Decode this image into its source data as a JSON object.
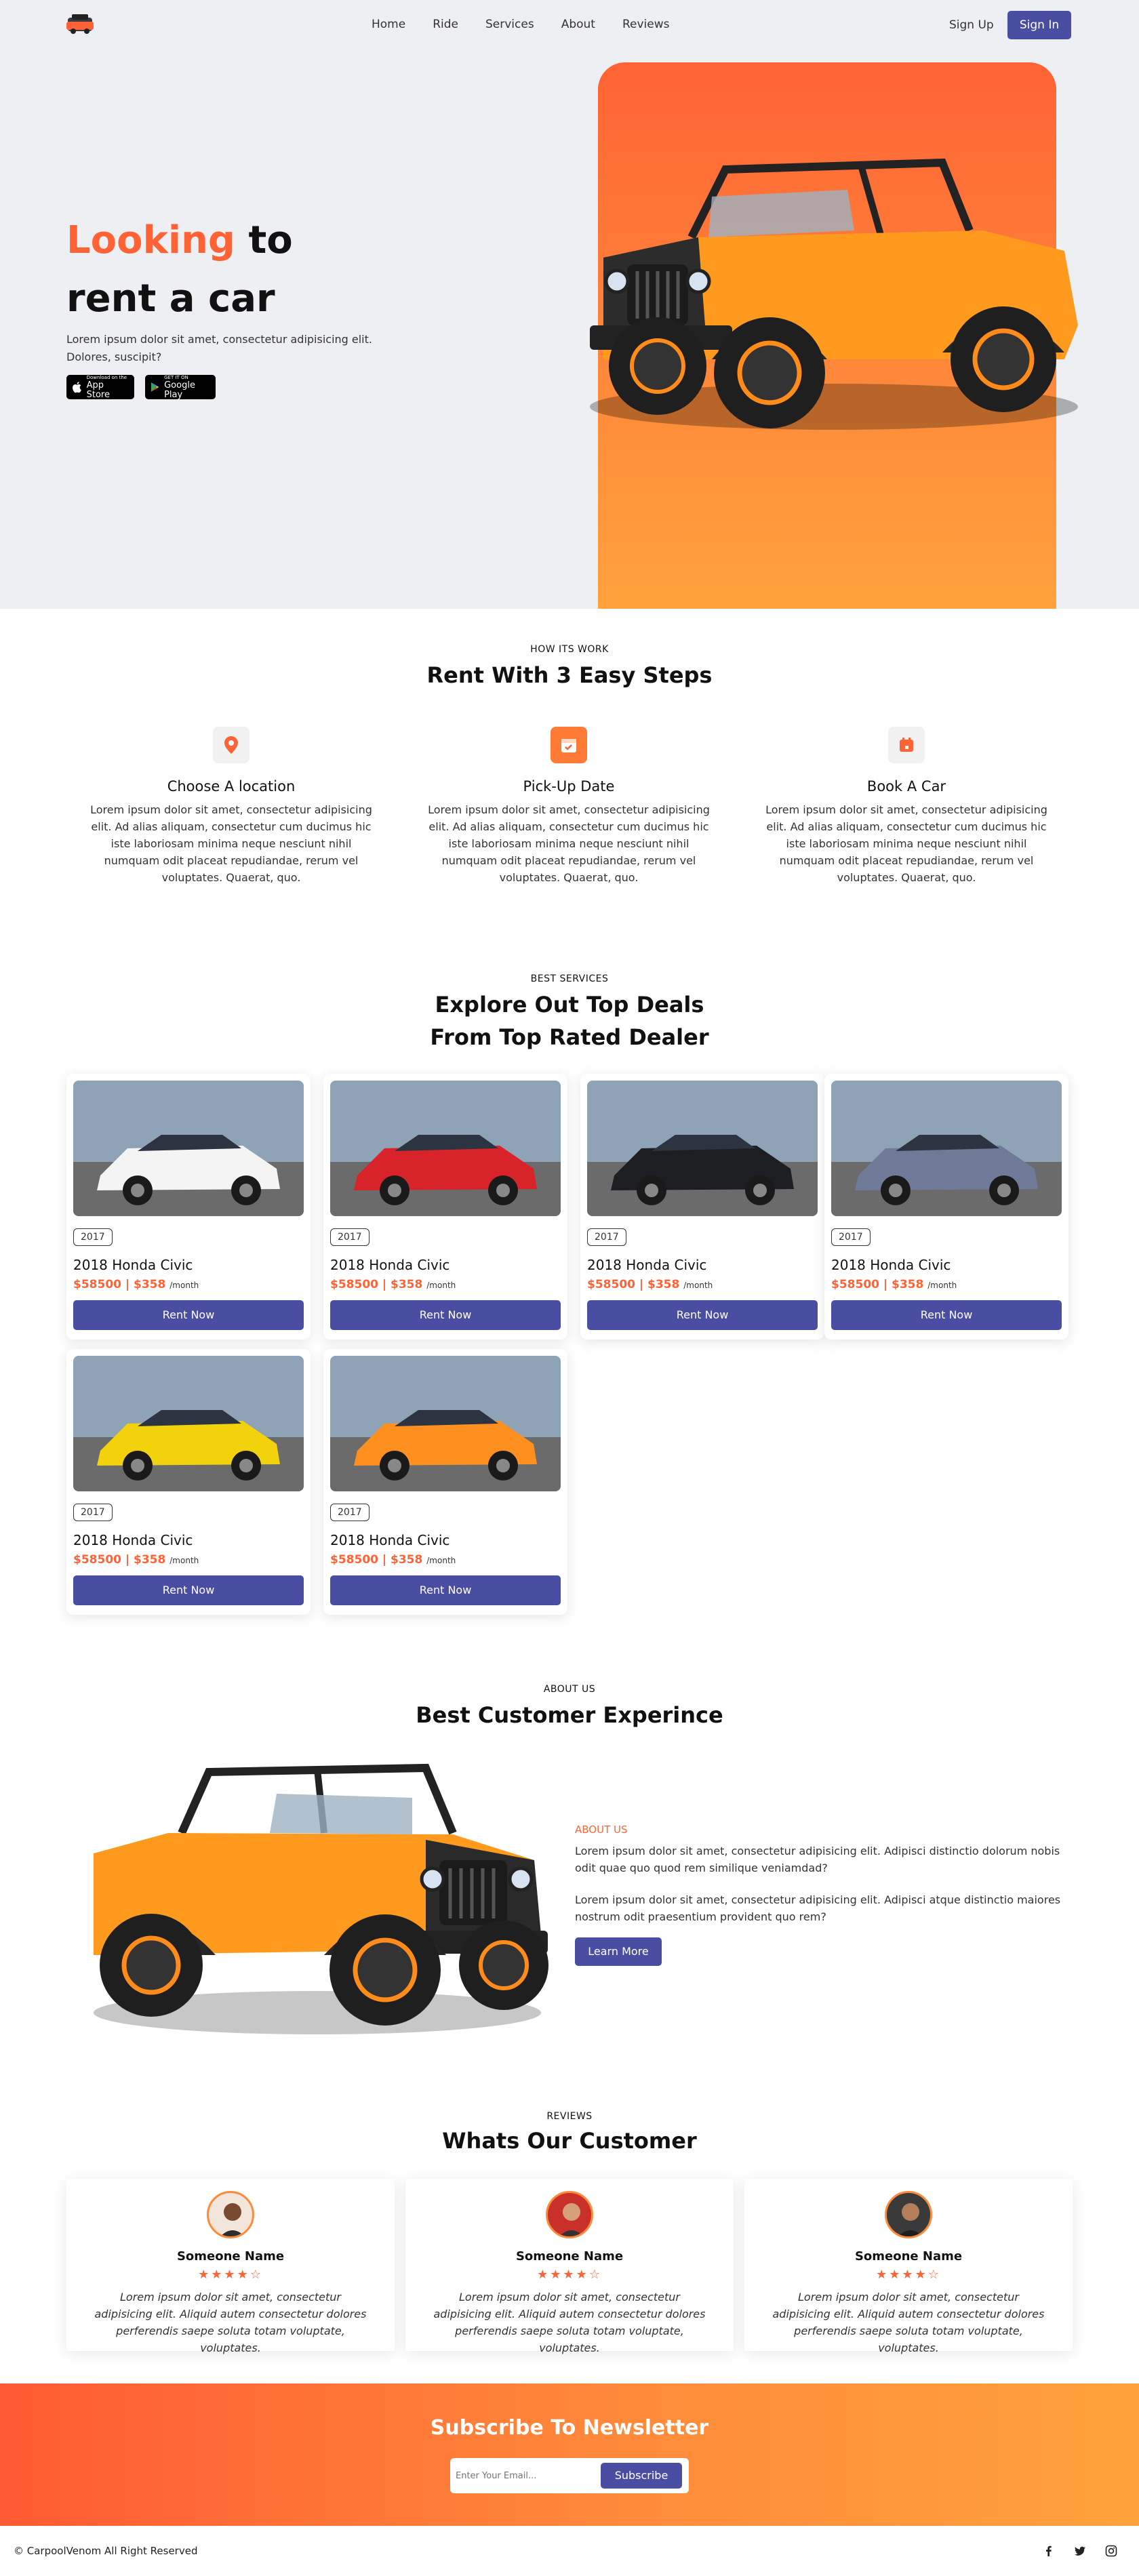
{
  "nav": {
    "links": [
      "Home",
      "Ride",
      "Services",
      "About",
      "Reviews"
    ],
    "signup": "Sign Up",
    "signin": "Sign In"
  },
  "hero": {
    "title_accent": "Looking",
    "title_rest1": "to",
    "title_line2": "rent a car",
    "description": "Lorem ipsum dolor sit amet, consectetur adipisicing elit. Dolores, suscipit?",
    "appstore_small": "Download on the",
    "appstore_big": "App Store",
    "googleplay_small": "GET IT ON",
    "googleplay_big": "Google Play"
  },
  "steps": {
    "kicker": "HOW ITS WORK",
    "title": "Rent With 3 Easy Steps",
    "items": [
      {
        "title": "Choose A location",
        "text": "Lorem ipsum dolor sit amet, consectetur adipisicing elit. Ad alias aliquam, consectetur cum ducimus hic iste laboriosam minima neque nesciunt nihil numquam odit placeat repudiandae, rerum vel voluptates. Quaerat, quo."
      },
      {
        "title": "Pick-Up Date",
        "text": "Lorem ipsum dolor sit amet, consectetur adipisicing elit. Ad alias aliquam, consectetur cum ducimus hic iste laboriosam minima neque nesciunt nihil numquam odit placeat repudiandae, rerum vel voluptates. Quaerat, quo."
      },
      {
        "title": "Book A Car",
        "text": "Lorem ipsum dolor sit amet, consectetur adipisicing elit. Ad alias aliquam, consectetur cum ducimus hic iste laboriosam minima neque nesciunt nihil numquam odit placeat repudiandae, rerum vel voluptates. Quaerat, quo."
      }
    ]
  },
  "deals": {
    "kicker": "BEST SERVICES",
    "title_line1": "Explore Out Top Deals",
    "title_line2": "From Top Rated Dealer",
    "cards": [
      {
        "year": "2017",
        "name": "2018 Honda Civic",
        "price": "$58500 | $358",
        "per": "/month",
        "button": "Rent Now",
        "color": "#f4f4f4"
      },
      {
        "year": "2017",
        "name": "2018 Honda Civic",
        "price": "$58500 | $358",
        "per": "/month",
        "button": "Rent Now",
        "color": "#d8232a"
      },
      {
        "year": "2017",
        "name": "2018 Honda Civic",
        "price": "$58500 | $358",
        "per": "/month",
        "button": "Rent Now",
        "color": "#1c1e22"
      },
      {
        "year": "2017",
        "name": "2018 Honda Civic",
        "price": "$58500 | $358",
        "per": "/month",
        "button": "Rent Now",
        "color": "#6f7a98"
      },
      {
        "year": "2017",
        "name": "2018 Honda Civic",
        "price": "$58500 | $358",
        "per": "/month",
        "button": "Rent Now",
        "color": "#f2d20c"
      },
      {
        "year": "2017",
        "name": "2018 Honda Civic",
        "price": "$58500 | $358",
        "per": "/month",
        "button": "Rent Now",
        "color": "#ff8f1f"
      }
    ]
  },
  "about": {
    "kicker": "ABOUT US",
    "title": "Best Customer Experince",
    "label": "ABOUT US",
    "p1": "Lorem ipsum dolor sit amet, consectetur adipisicing elit. Adipisci distinctio dolorum nobis odit quae quo quod rem similique veniamdad?",
    "p2": "Lorem ipsum dolor sit amet, consectetur adipisicing elit. Adipisci atque distinctio maiores nostrum odit praesentium provident quo rem?",
    "button": "Learn More"
  },
  "reviews": {
    "kicker": "REVIEWS",
    "title": "Whats Our Customer",
    "items": [
      {
        "name": "Someone Name",
        "stars": "★★★★☆",
        "text": "Lorem ipsum dolor sit amet, consectetur adipisicing elit. Aliquid autem consectetur dolores perferendis saepe soluta totam voluptate, voluptates."
      },
      {
        "name": "Someone Name",
        "stars": "★★★★☆",
        "text": "Lorem ipsum dolor sit amet, consectetur adipisicing elit. Aliquid autem consectetur dolores perferendis saepe soluta totam voluptate, voluptates."
      },
      {
        "name": "Someone Name",
        "stars": "★★★★☆",
        "text": "Lorem ipsum dolor sit amet, consectetur adipisicing elit. Aliquid autem consectetur dolores perferendis saepe soluta totam voluptate, voluptates."
      }
    ]
  },
  "newsletter": {
    "title": "Subscribe To Newsletter",
    "placeholder": "Enter Your Email...",
    "button": "Subscribe"
  },
  "footer": {
    "copyright": "© CarpoolVenom All Right Reserved",
    "social": [
      "facebook-icon",
      "twitter-icon",
      "instagram-icon"
    ]
  },
  "colors": {
    "accent": "#ff6335",
    "primary": "#4a4ea2",
    "hero_bg": "#eeeff2"
  }
}
